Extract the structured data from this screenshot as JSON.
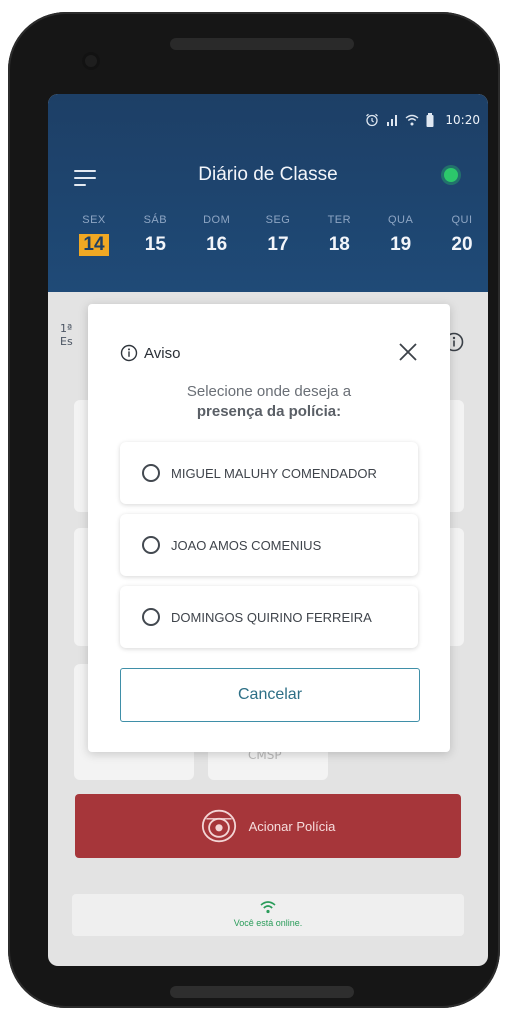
{
  "status_bar": {
    "time": "10:20",
    "icons": [
      "alarm-icon",
      "signal-icon",
      "wifi-icon",
      "battery-icon"
    ]
  },
  "header": {
    "title": "Diário de Classe",
    "online_color": "#2cc86b"
  },
  "days": [
    {
      "name": "SEX",
      "num": "14",
      "selected": true
    },
    {
      "name": "SÁB",
      "num": "15"
    },
    {
      "name": "DOM",
      "num": "16"
    },
    {
      "name": "SEG",
      "num": "17"
    },
    {
      "name": "TER",
      "num": "18"
    },
    {
      "name": "QUA",
      "num": "19"
    },
    {
      "name": "QUI",
      "num": "20"
    }
  ],
  "background": {
    "ordinal": "1ª",
    "abbr": "Es",
    "card_label": "CMSP",
    "police_button": "Acionar Polícia",
    "online_status": "Você está online."
  },
  "modal": {
    "title": "Aviso",
    "message": "Selecione onde deseja a",
    "message_bold": "presença da polícia:",
    "options": [
      "MIGUEL MALUHY COMENDADOR",
      "JOAO AMOS COMENIUS",
      "DOMINGOS QUIRINO FERREIRA"
    ],
    "cancel_label": "Cancelar"
  },
  "colors": {
    "header": "#1f4a77",
    "accent": "#f0a823",
    "police": "#a6363a",
    "cancel_border": "#3f8fa8"
  }
}
